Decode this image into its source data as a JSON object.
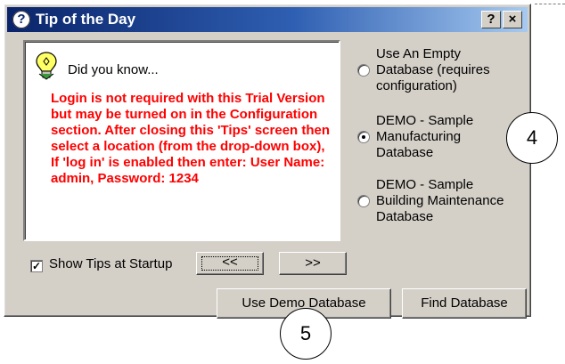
{
  "window": {
    "title": "Tip of the Day",
    "help_button": "?",
    "close_button": "×"
  },
  "tip": {
    "heading": "Did you know...",
    "text": "Login is not required with this Trial Version but may be turned on in the Configuration section. After closing this 'Tips' screen then select a location (from the drop-down box), If 'log in' is enabled then enter: User Name: admin, Password: 1234",
    "text_color": "#ff0000"
  },
  "options": [
    {
      "label": "Use An Empty Database (requires configuration)",
      "selected": false
    },
    {
      "label": "DEMO - Sample Manufacturing Database",
      "selected": true
    },
    {
      "label": "DEMO - Sample Building Maintenance Database",
      "selected": false
    }
  ],
  "startup": {
    "checkbox_label": "Show Tips at Startup",
    "checked": true
  },
  "nav": {
    "prev_label": "<<",
    "next_label": ">>"
  },
  "actions": {
    "demo_label": "Use Demo Database",
    "find_label": "Find Database"
  },
  "callouts": {
    "step4": "4",
    "step5": "5"
  },
  "icons": {
    "title": "help-icon",
    "tip": "lightbulb-icon"
  },
  "colors": {
    "titlebar_start": "#0a246a",
    "titlebar_end": "#a6caf0",
    "dialog_bg": "#d4d0c8"
  }
}
